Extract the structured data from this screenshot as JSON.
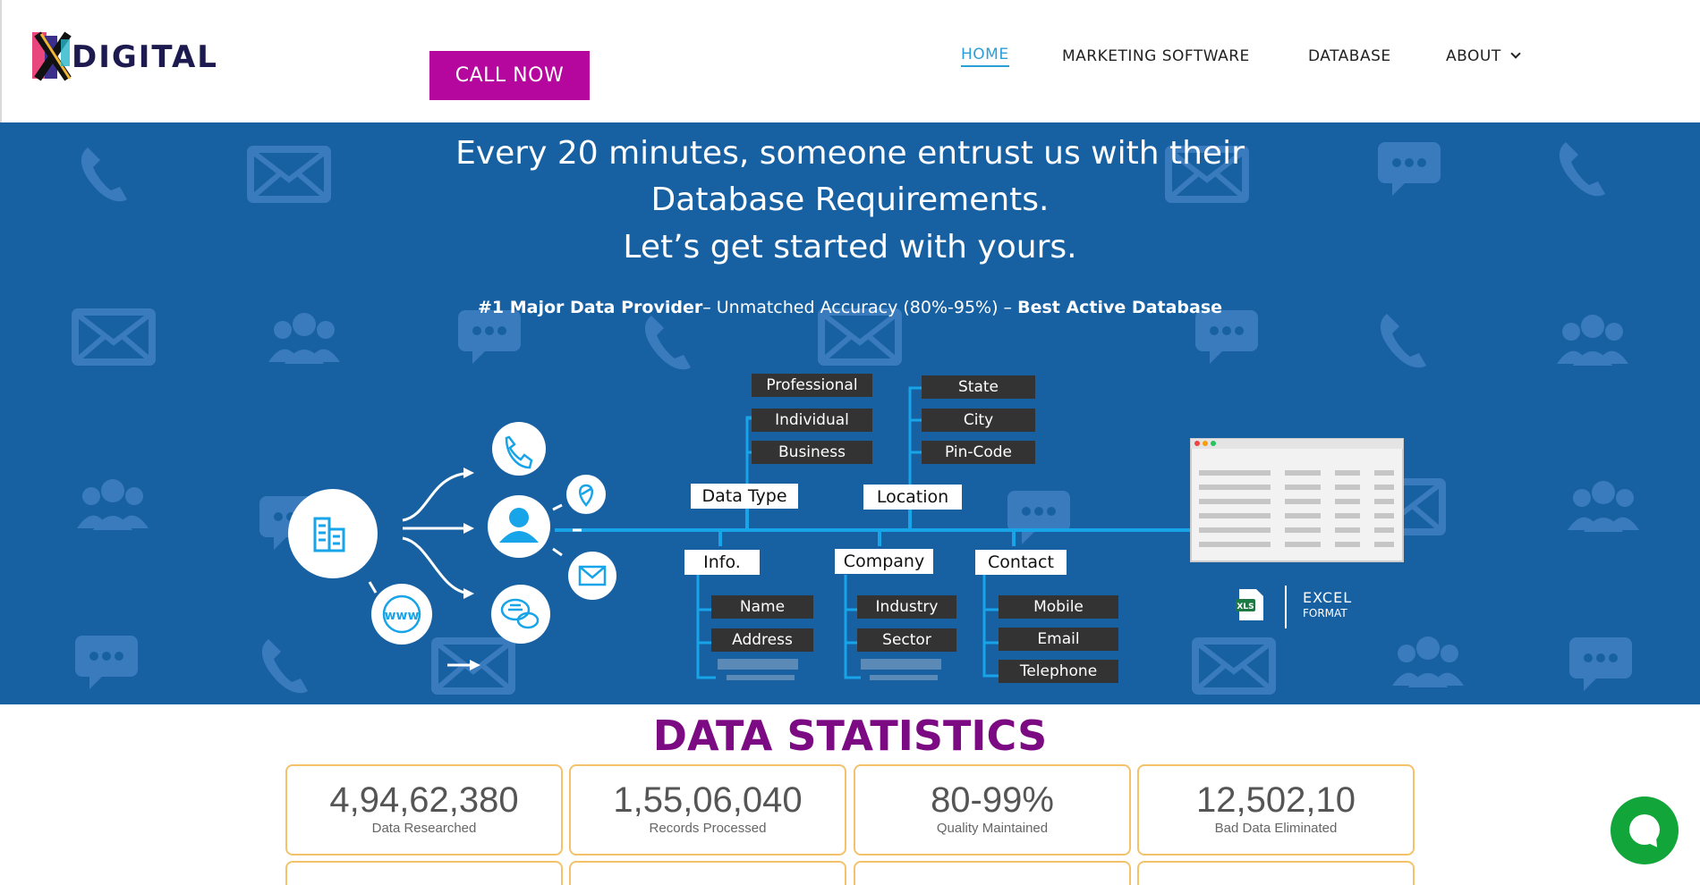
{
  "brand": {
    "logo_text": "DIGITAL",
    "colors": {
      "header_bg": "#ffffff",
      "hero_bg": "#1761a3",
      "accent_magenta": "#b5079d",
      "title_purple": "#7c0a82",
      "nav_active": "#2a9fd6",
      "card_border": "#f3c26b",
      "chat_green": "#12a53a"
    }
  },
  "header": {
    "call_label": "CALL NOW",
    "nav": [
      {
        "label": "HOME",
        "active": true
      },
      {
        "label": "MARKETING SOFTWARE",
        "active": false
      },
      {
        "label": "DATABASE",
        "active": false
      },
      {
        "label": "ABOUT",
        "active": false,
        "has_dropdown": true
      }
    ]
  },
  "hero": {
    "line1": "Every 20 minutes, someone entrust us with their",
    "line2": "Database Requirements.",
    "line3": "Let’s get started with yours.",
    "sub_bold1": "#1 Major Data Provider",
    "sub_mid": "– Unmatched Accuracy (80%-95%) – ",
    "sub_bold2": "Best Active Database",
    "diagram": {
      "data_type": {
        "label": "Data Type",
        "items": [
          "Professional",
          "Individual",
          "Business"
        ]
      },
      "location": {
        "label": "Location",
        "items": [
          "State",
          "City",
          "Pin-Code"
        ]
      },
      "info": {
        "label": "Info.",
        "items": [
          "Name",
          "Address"
        ]
      },
      "company": {
        "label": "Company",
        "items": [
          "Industry",
          "Sector"
        ]
      },
      "contact": {
        "label": "Contact",
        "items": [
          "Mobile",
          "Email",
          "Telephone"
        ]
      },
      "excel": {
        "badge": "XLS",
        "line1": "EXCEL",
        "line2": "FORMAT"
      },
      "icons": [
        "building-icon",
        "phone-icon",
        "user-icon",
        "location-pin-icon",
        "mail-icon",
        "chat-icon",
        "www-icon"
      ],
      "www_text": "www"
    }
  },
  "stats": {
    "title": "DATA STATISTICS",
    "cards": [
      {
        "value": "4,94,62,380",
        "label": "Data Researched"
      },
      {
        "value": "1,55,06,040",
        "label": "Records Processed"
      },
      {
        "value": "80-99%",
        "label": "Quality Maintained"
      },
      {
        "value": "12,502,10",
        "label": "Bad Data Eliminated"
      }
    ]
  },
  "chat": {
    "icon": "chat-bubble-icon"
  }
}
